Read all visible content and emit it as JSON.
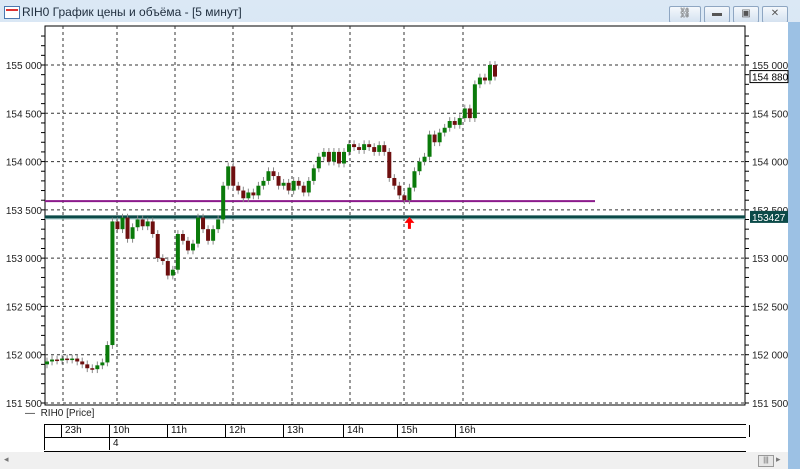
{
  "window": {
    "title": "RIH0 График цены и объёма - [5 минут]",
    "buttons": [
      "restore-layout",
      "minimize",
      "maximize",
      "close"
    ]
  },
  "legend": {
    "label": "RIH0 [Price]"
  },
  "time_axis": {
    "hours": [
      "23h",
      "10h",
      "11h",
      "12h",
      "13h",
      "14h",
      "15h",
      "16h"
    ],
    "day": "4"
  },
  "chart_data": {
    "type": "candlestick",
    "symbol": "RIH0",
    "interval": "5 минут",
    "ylim": [
      151500,
      155300
    ],
    "y_ticks": [
      "155 000",
      "154 500",
      "154 000",
      "153 500",
      "153 000",
      "152 500",
      "152 000",
      "151 500"
    ],
    "y_tick_values": [
      155000,
      154500,
      154000,
      153500,
      153000,
      152500,
      152000,
      151500
    ],
    "last_price_label": "154 880",
    "grid": true,
    "colors": {
      "up": "#0a7a0a",
      "down": "#6e0f0f",
      "wick": "#888888"
    },
    "closes": [
      151930,
      151950,
      151940,
      151960,
      151950,
      151960,
      151930,
      151900,
      151860,
      151850,
      151890,
      151920,
      152100,
      153380,
      153300,
      153420,
      153200,
      153320,
      153400,
      153330,
      153380,
      153250,
      153000,
      152970,
      152820,
      152880,
      153250,
      153180,
      153080,
      153150,
      153420,
      153300,
      153180,
      153300,
      153400,
      153750,
      153950,
      153750,
      153700,
      153620,
      153680,
      153650,
      153750,
      153800,
      153900,
      153850,
      153750,
      153780,
      153700,
      153800,
      153750,
      153680,
      153800,
      153930,
      154050,
      154100,
      154000,
      154100,
      153980,
      154100,
      154180,
      154150,
      154120,
      154180,
      154150,
      154100,
      154170,
      154100,
      153830,
      153750,
      153650,
      153600,
      153730,
      153900,
      154000,
      154050,
      154280,
      154200,
      154300,
      154350,
      154420,
      154380,
      154450,
      154550,
      154450,
      154800,
      154870,
      154840,
      155000,
      154880
    ],
    "first_open": 151900,
    "levels": [
      {
        "price": 153590,
        "color": "#8b1a8b",
        "label": ""
      },
      {
        "price": 153427,
        "color": "#0b4a48",
        "label": "153427"
      }
    ],
    "marker": {
      "type": "up-arrow",
      "color": "#ff0000",
      "candle_index": 72
    }
  }
}
